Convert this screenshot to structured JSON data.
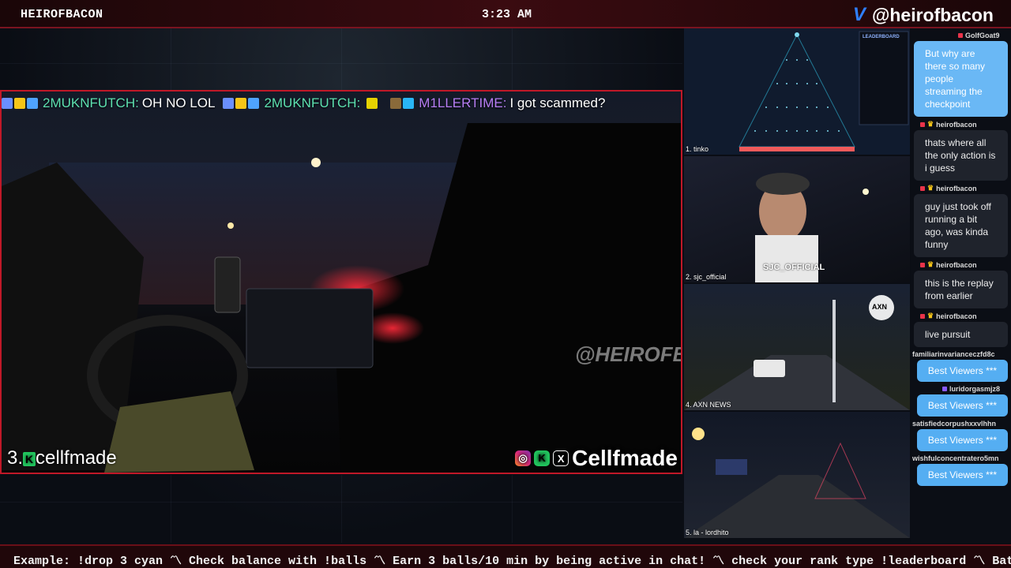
{
  "header": {
    "channel_name": "HEIROFBACON",
    "clock": "3:23 AM",
    "social_handle": "@heirofbacon"
  },
  "main_stream": {
    "chat_overlay": [
      {
        "user": "2MUKNFUTCH:",
        "text": "OH NO LOL"
      },
      {
        "user": "2MUKNFUTCH:",
        "text": ""
      },
      {
        "user": "M1LLERTIME:",
        "text": "I got scammed?"
      }
    ],
    "rank_number": "3.",
    "streamer_name": "cellfmade",
    "socials_name": "Cellfmade",
    "watermark": "@HEIROFBACON"
  },
  "side_cams": [
    {
      "label": "1. tinko"
    },
    {
      "label": "2. sjc_official",
      "overlay": "SJC_OFFICIAL"
    },
    {
      "label": "4. AXN NEWS",
      "overlay": "AXN"
    },
    {
      "label": "5. la - lordhito"
    }
  ],
  "plinko_leaderboard_title": "LEADERBOARD",
  "chat_panel": [
    {
      "user": "GolfGoat9",
      "text": "But why are there so many people streaming the checkpoint",
      "style": "blue"
    },
    {
      "user": "heirofbacon",
      "text": "thats where all the only action is i guess",
      "style": "me"
    },
    {
      "user": "heirofbacon",
      "text": "guy just took off running a bit ago, was kinda funny",
      "style": "me"
    },
    {
      "user": "heirofbacon",
      "text": "this is the replay from earlier",
      "style": "me"
    },
    {
      "user": "heirofbacon",
      "text": "live pursuit",
      "style": "me"
    },
    {
      "user": "familiarinvarianceczfd8c",
      "text": "Best Viewers ***",
      "style": "best"
    },
    {
      "user": "luridorgasmjz8",
      "text": "Best Viewers ***",
      "style": "best"
    },
    {
      "user": "satisfiedcorpushxxvlhhn",
      "text": "Best Viewers ***",
      "style": "best"
    },
    {
      "user": "wishfulconcentratero5mn",
      "text": "Best Viewers ***",
      "style": "best"
    }
  ],
  "ticker": {
    "text": "Example: !drop 3 cyan  〽  Check balance with !balls  〽  Earn 3 balls/10 min by being active in chat!  〽  check your rank type !leaderboard  〽  Bat"
  },
  "colors": {
    "accent_red": "#c01828",
    "chat_blue": "#55aef2",
    "username_green": "#5de0b0",
    "username_purple": "#b77ef5"
  }
}
